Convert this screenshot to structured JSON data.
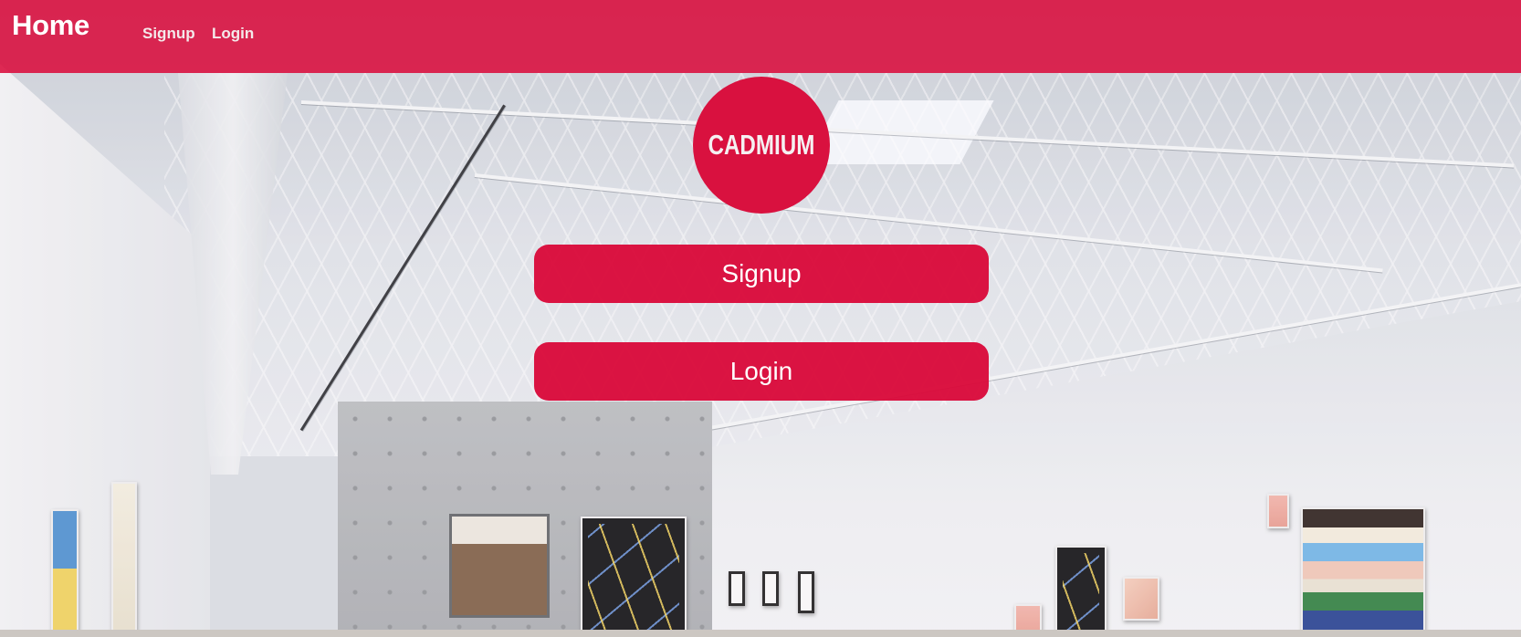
{
  "nav": {
    "brand": "Home",
    "links": [
      {
        "label": "Signup"
      },
      {
        "label": "Login"
      }
    ]
  },
  "logo": {
    "text": "CADMIUM"
  },
  "actions": {
    "signup_label": "Signup",
    "login_label": "Login"
  },
  "colors": {
    "brand_red": "#d90c3c",
    "text_on_red": "#ffffff"
  }
}
